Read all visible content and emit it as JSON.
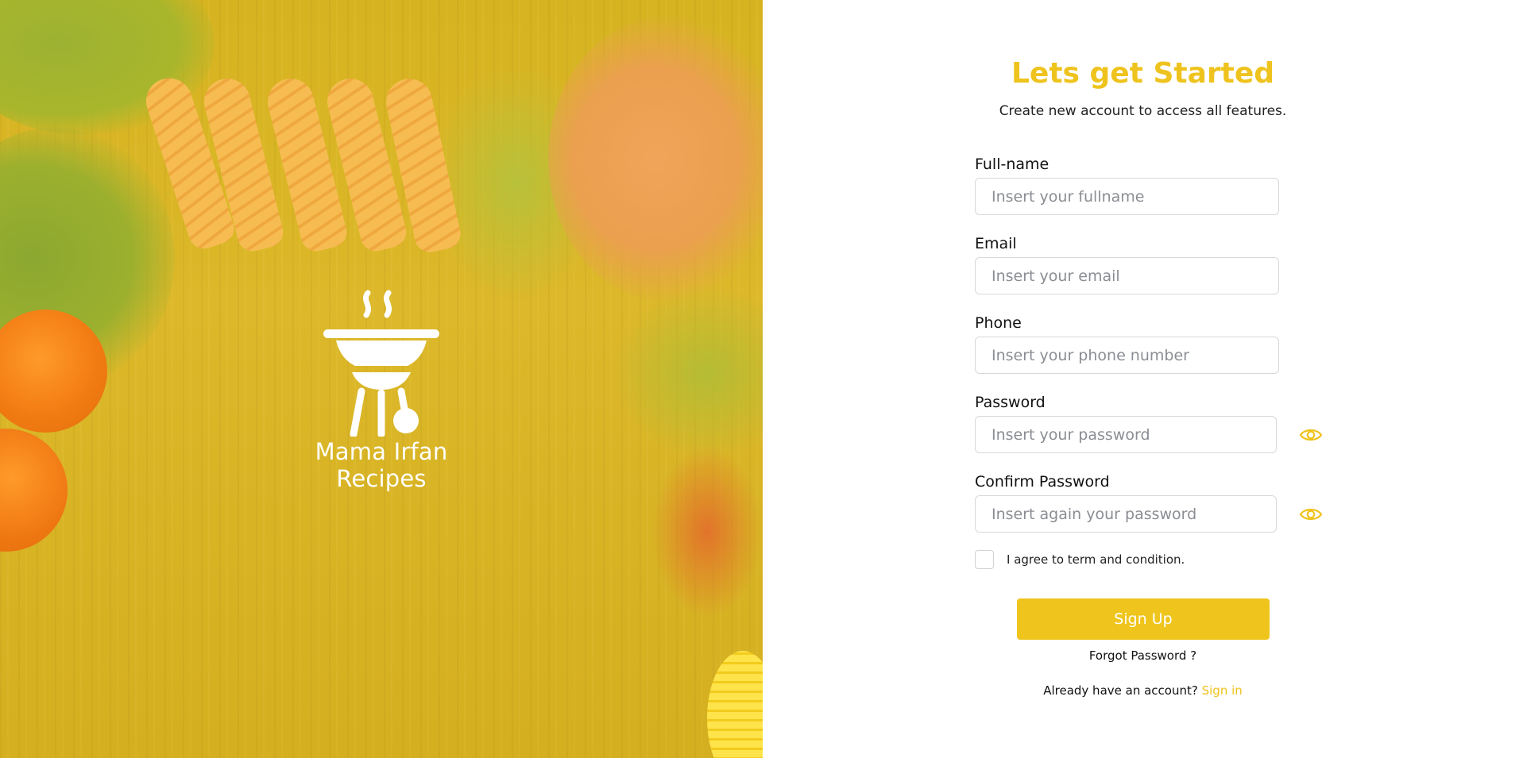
{
  "brand": {
    "name": "Mama Irfan Recipes",
    "logo_icon": "grill-icon",
    "accent_color": "#efc31d"
  },
  "form": {
    "title": "Lets get Started",
    "subtitle": "Create new account to access all features.",
    "fields": {
      "fullname": {
        "label": "Full-name",
        "placeholder": "Insert your fullname",
        "value": ""
      },
      "email": {
        "label": "Email",
        "placeholder": "Insert your email",
        "value": ""
      },
      "phone": {
        "label": "Phone",
        "placeholder": "Insert your phone number",
        "value": ""
      },
      "password": {
        "label": "Password",
        "placeholder": "Insert your password",
        "value": "",
        "toggle_icon": "eye-icon"
      },
      "confirm_password": {
        "label": "Confirm Password",
        "placeholder": "Insert again your password",
        "value": "",
        "toggle_icon": "eye-icon"
      }
    },
    "agree_label": "I agree to term and condition.",
    "agree_checked": false,
    "submit_label": "Sign Up",
    "forgot_label": "Forgot Password ?",
    "already_text": "Already have an account?",
    "signin_label": "Sign in"
  }
}
